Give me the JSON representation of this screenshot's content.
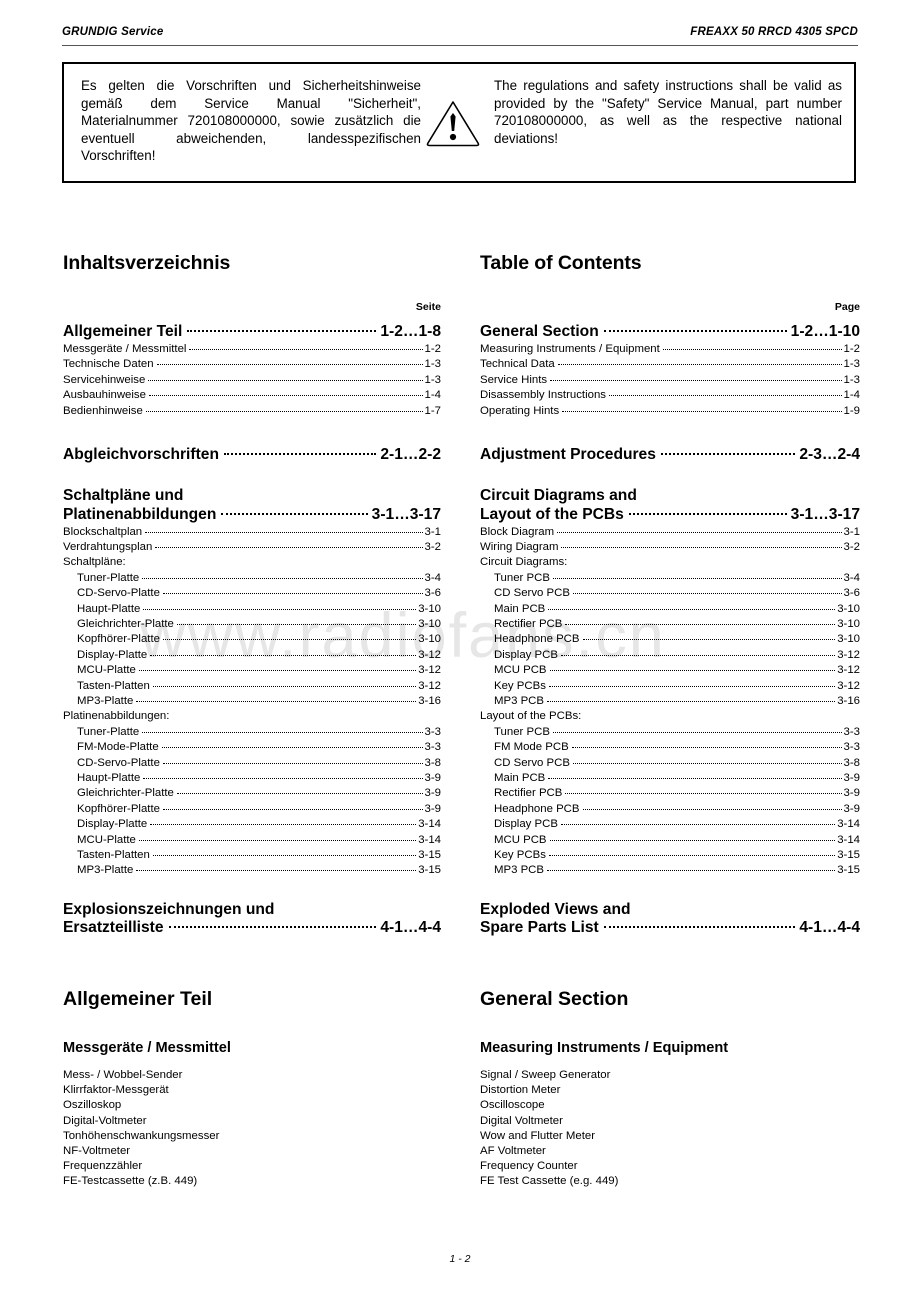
{
  "header": {
    "left": "GRUNDIG Service",
    "right": "FREAXX 50 RRCD 4305 SPCD"
  },
  "watermark": {
    "text": "www.radiofans.cn"
  },
  "safety_box": {
    "icon": "warning-triangle-icon",
    "german": "Es gelten die Vorschriften und Sicherheitshinweise gemäß dem Service Manual \"Sicherheit\", Materialnummer 720108000000, sowie zusätzlich die eventuell abweichenden, landesspezifischen Vorschriften!",
    "english": "The regulations and safety instructions shall be valid as provided by the \"Safety\" Service Manual, part number 720108000000, as well as the respective national deviations!"
  },
  "toc_de": {
    "title": "Inhaltsverzeichnis",
    "page_label": "Seite",
    "general": {
      "label": "Allgemeiner Teil",
      "page": "1-2…1-8",
      "items": [
        {
          "label": "Messgeräte / Messmittel",
          "page": "1-2"
        },
        {
          "label": "Technische Daten",
          "page": "1-3"
        },
        {
          "label": "Servicehinweise",
          "page": "1-3"
        },
        {
          "label": "Ausbauhinweise",
          "page": "1-4"
        },
        {
          "label": "Bedienhinweise",
          "page": "1-7"
        }
      ]
    },
    "adjustment": {
      "label": "Abgleichvorschriften",
      "page": "2-1…2-2"
    },
    "circuits": {
      "label_line1": "Schaltpläne und",
      "label_line2": "Platinenabbildungen",
      "page": "3-1…3-17",
      "top_items": [
        {
          "label": "Blockschaltplan",
          "page": "3-1"
        },
        {
          "label": "Verdrahtungsplan",
          "page": "3-2"
        }
      ],
      "group1_label": "Schaltpläne:",
      "group1_items": [
        {
          "label": "Tuner-Platte",
          "page": "3-4"
        },
        {
          "label": "CD-Servo-Platte",
          "page": "3-6"
        },
        {
          "label": "Haupt-Platte",
          "page": "3-10"
        },
        {
          "label": "Gleichrichter-Platte",
          "page": "3-10"
        },
        {
          "label": "Kopfhörer-Platte",
          "page": "3-10"
        },
        {
          "label": "Display-Platte",
          "page": "3-12"
        },
        {
          "label": "MCU-Platte",
          "page": "3-12"
        },
        {
          "label": "Tasten-Platten",
          "page": "3-12"
        },
        {
          "label": "MP3-Platte",
          "page": "3-16"
        }
      ],
      "group2_label": "Platinenabbildungen:",
      "group2_items": [
        {
          "label": "Tuner-Platte",
          "page": "3-3"
        },
        {
          "label": "FM-Mode-Platte",
          "page": "3-3"
        },
        {
          "label": "CD-Servo-Platte",
          "page": "3-8"
        },
        {
          "label": "Haupt-Platte",
          "page": "3-9"
        },
        {
          "label": "Gleichrichter-Platte",
          "page": "3-9"
        },
        {
          "label": "Kopfhörer-Platte",
          "page": "3-9"
        },
        {
          "label": "Display-Platte",
          "page": "3-14"
        },
        {
          "label": "MCU-Platte",
          "page": "3-14"
        },
        {
          "label": "Tasten-Platten",
          "page": "3-15"
        },
        {
          "label": "MP3-Platte",
          "page": "3-15"
        }
      ]
    },
    "exploded": {
      "label_line1": "Explosionszeichnungen und",
      "label_line2": "Ersatzteilliste",
      "page": "4-1…4-4"
    }
  },
  "toc_en": {
    "title": "Table of Contents",
    "page_label": "Page",
    "general": {
      "label": "General Section",
      "page": "1-2…1-10",
      "items": [
        {
          "label": "Measuring Instruments / Equipment",
          "page": "1-2"
        },
        {
          "label": "Technical Data",
          "page": "1-3"
        },
        {
          "label": "Service Hints",
          "page": "1-3"
        },
        {
          "label": "Disassembly Instructions",
          "page": "1-4"
        },
        {
          "label": "Operating Hints",
          "page": "1-9"
        }
      ]
    },
    "adjustment": {
      "label": "Adjustment Procedures",
      "page": "2-3…2-4"
    },
    "circuits": {
      "label_line1": "Circuit Diagrams and",
      "label_line2": "Layout of the PCBs",
      "page": "3-1…3-17",
      "top_items": [
        {
          "label": "Block Diagram",
          "page": "3-1"
        },
        {
          "label": "Wiring Diagram",
          "page": "3-2"
        }
      ],
      "group1_label": "Circuit Diagrams:",
      "group1_items": [
        {
          "label": "Tuner PCB",
          "page": "3-4"
        },
        {
          "label": "CD Servo PCB",
          "page": "3-6"
        },
        {
          "label": "Main PCB",
          "page": "3-10"
        },
        {
          "label": "Rectifier PCB",
          "page": "3-10"
        },
        {
          "label": "Headphone PCB",
          "page": "3-10"
        },
        {
          "label": "Display PCB",
          "page": "3-12"
        },
        {
          "label": "MCU PCB",
          "page": "3-12"
        },
        {
          "label": "Key PCBs",
          "page": "3-12"
        },
        {
          "label": "MP3 PCB",
          "page": "3-16"
        }
      ],
      "group2_label": "Layout of the PCBs:",
      "group2_items": [
        {
          "label": "Tuner PCB",
          "page": "3-3"
        },
        {
          "label": "FM Mode PCB",
          "page": "3-3"
        },
        {
          "label": "CD Servo PCB",
          "page": "3-8"
        },
        {
          "label": "Main PCB",
          "page": "3-9"
        },
        {
          "label": "Rectifier PCB",
          "page": "3-9"
        },
        {
          "label": "Headphone PCB",
          "page": "3-9"
        },
        {
          "label": "Display PCB",
          "page": "3-14"
        },
        {
          "label": "MCU PCB",
          "page": "3-14"
        },
        {
          "label": "Key PCBs",
          "page": "3-15"
        },
        {
          "label": "MP3 PCB",
          "page": "3-15"
        }
      ]
    },
    "exploded": {
      "label_line1": "Exploded Views and",
      "label_line2": "Spare Parts List",
      "page": "4-1…4-4"
    }
  },
  "section_de": {
    "heading": "Allgemeiner Teil",
    "subheading": "Messgeräte / Messmittel",
    "equipment": [
      "Mess- / Wobbel-Sender",
      "Klirrfaktor-Messgerät",
      "Oszilloskop",
      "Digital-Voltmeter",
      "Tonhöhenschwankungsmesser",
      "NF-Voltmeter",
      "Frequenzzähler",
      "FE-Testcassette (z.B. 449)"
    ]
  },
  "section_en": {
    "heading": "General Section",
    "subheading": "Measuring Instruments / Equipment",
    "equipment": [
      "Signal / Sweep Generator",
      "Distortion Meter",
      "Oscilloscope",
      "Digital Voltmeter",
      "Wow and Flutter Meter",
      "AF Voltmeter",
      "Frequency Counter",
      "FE Test Cassette (e.g. 449)"
    ]
  },
  "footer": {
    "page_number": "1 - 2"
  }
}
